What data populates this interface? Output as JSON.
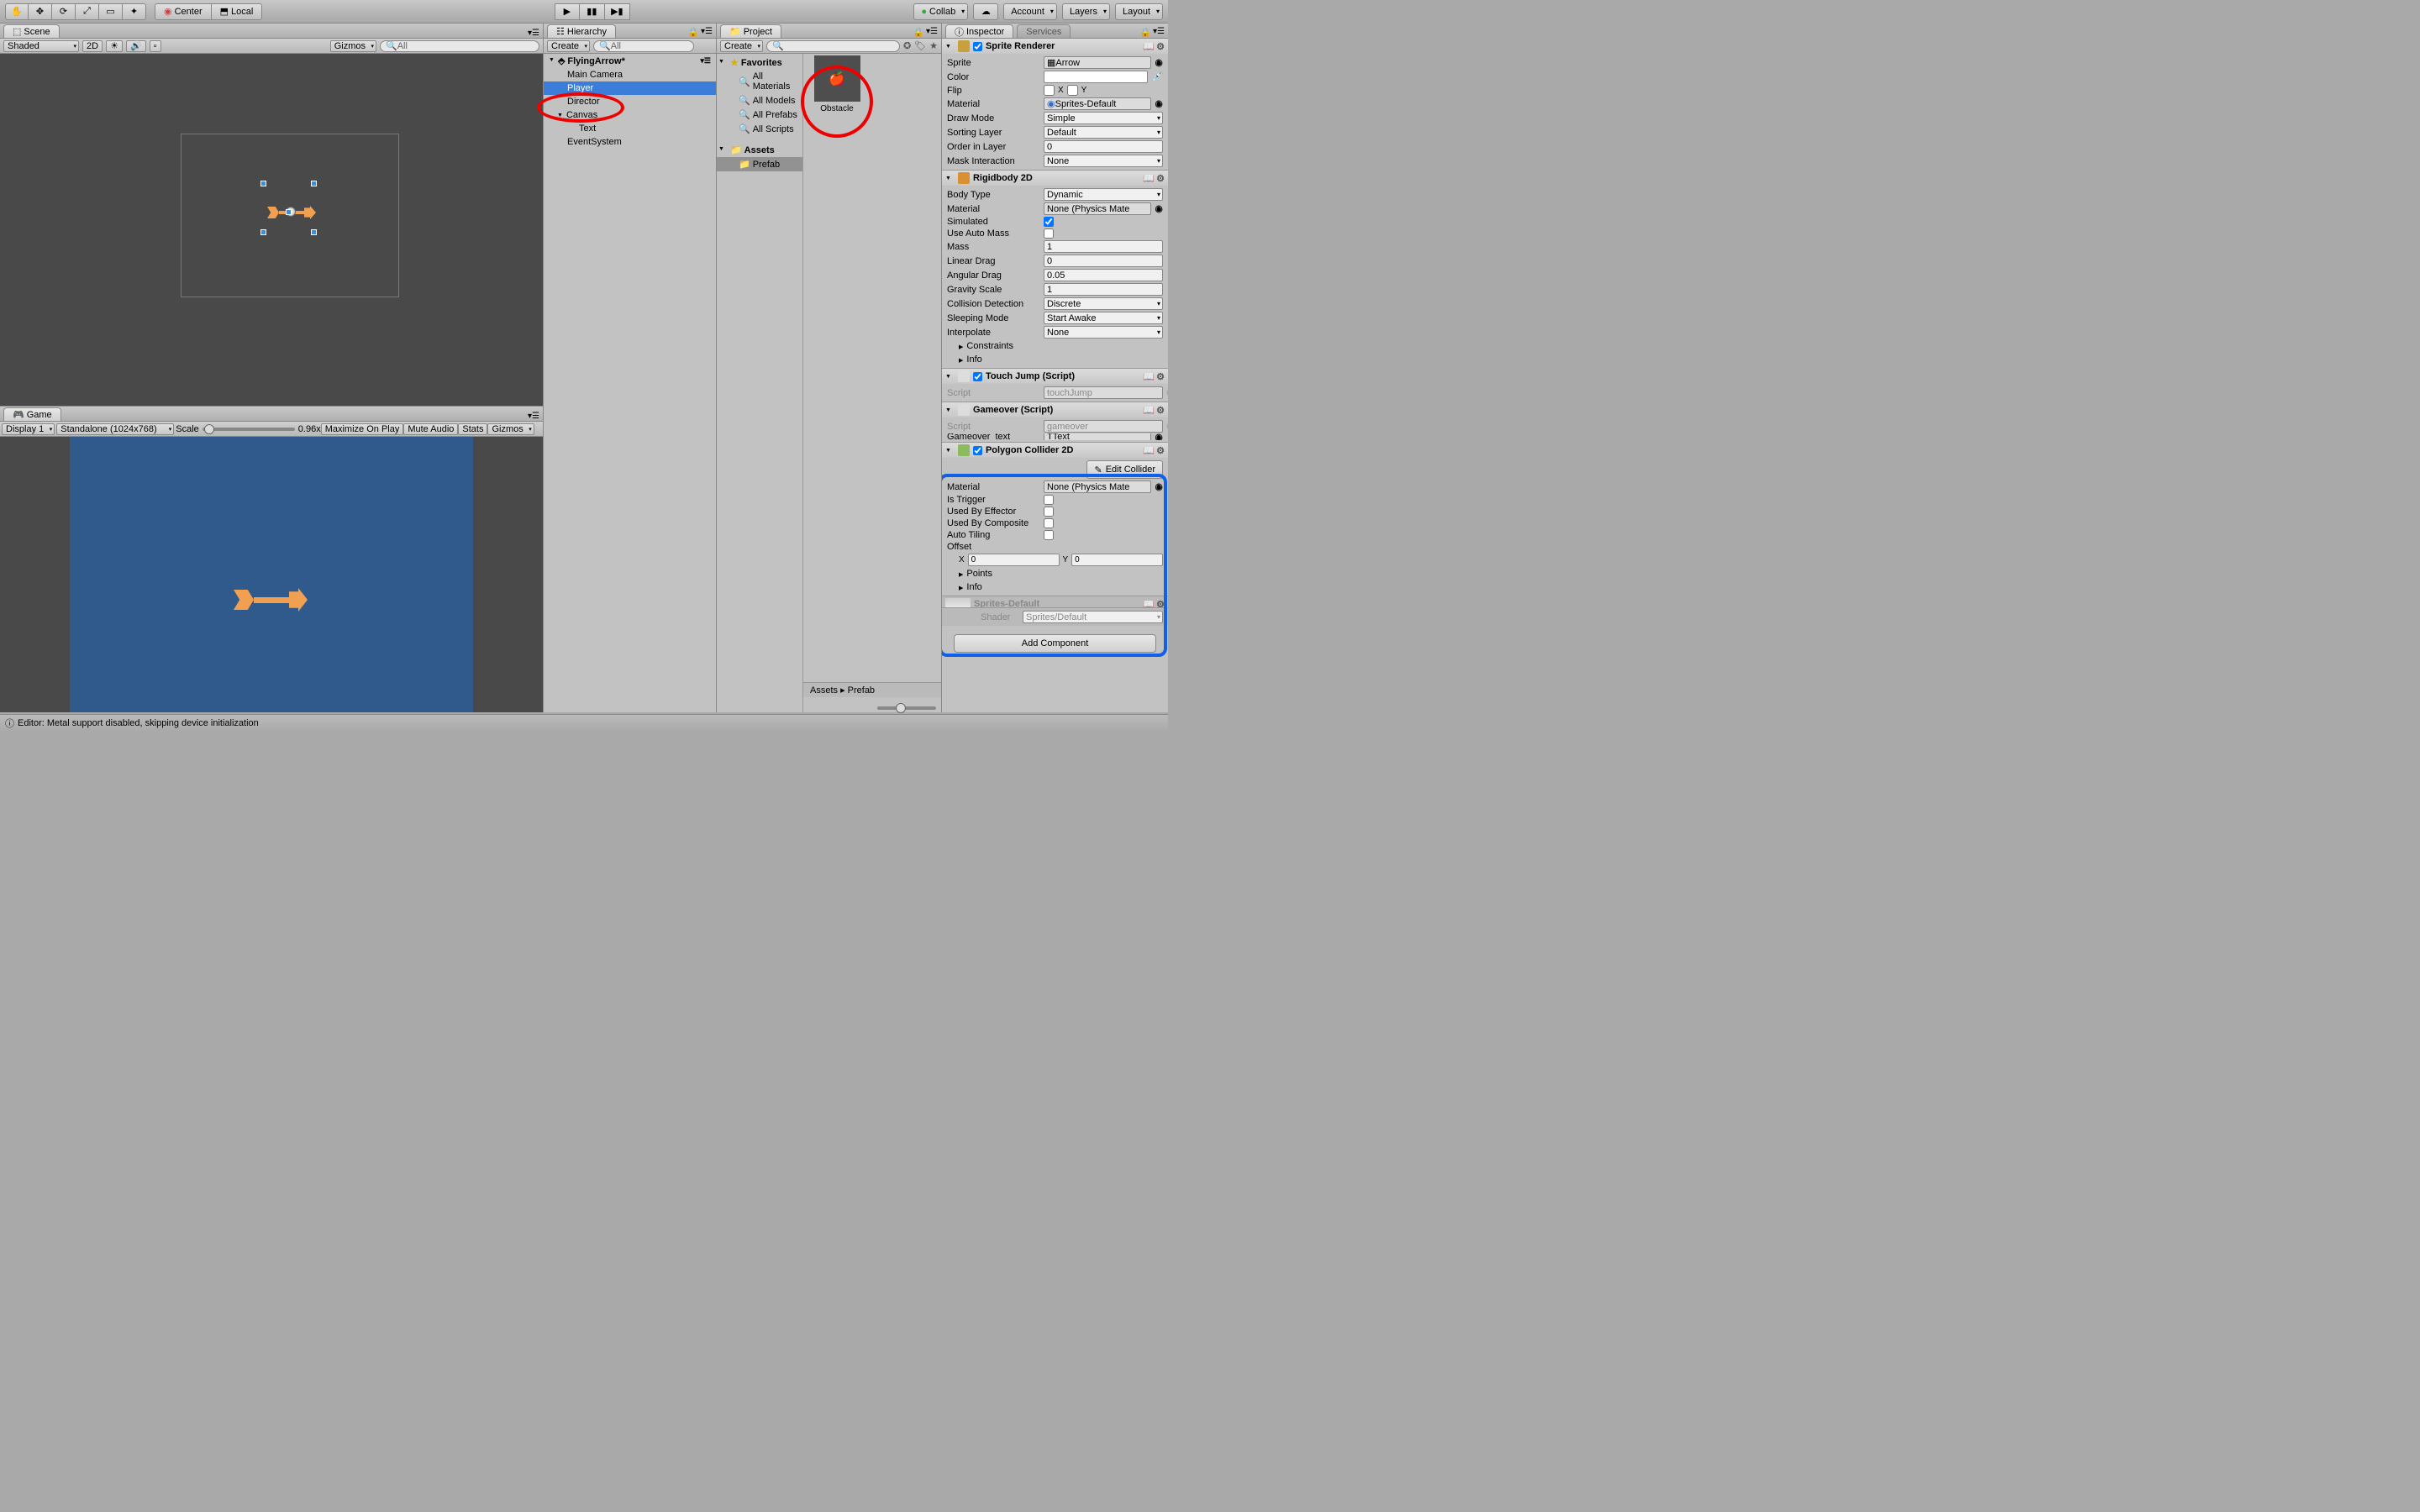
{
  "toolbar": {
    "center": "Center",
    "local": "Local",
    "collab": "Collab",
    "account": "Account",
    "layers": "Layers",
    "layout": "Layout"
  },
  "scene": {
    "tab": "Scene",
    "shading": "Shaded",
    "twod": "2D",
    "gizmos": "Gizmos",
    "search": "All"
  },
  "game": {
    "tab": "Game",
    "display": "Display 1",
    "resolution": "Standalone (1024x768)",
    "scale_label": "Scale",
    "scale_val": "0.96x",
    "maximize": "Maximize On Play",
    "mute": "Mute Audio",
    "stats": "Stats",
    "gizmos": "Gizmos"
  },
  "hierarchy": {
    "tab": "Hierarchy",
    "create": "Create",
    "scene_name": "FlyingArrow*",
    "items": [
      "Main Camera",
      "Player",
      "Director",
      "Canvas",
      "Text",
      "EventSystem"
    ]
  },
  "project": {
    "tab": "Project",
    "create": "Create",
    "favorites": "Favorites",
    "fav_items": [
      "All Materials",
      "All Models",
      "All Prefabs",
      "All Scripts"
    ],
    "assets": "Assets",
    "prefab_folder": "Prefab",
    "crumb": "Assets ▸ Prefab",
    "prefab_name": "Obstacle"
  },
  "inspector": {
    "tab_inspector": "Inspector",
    "tab_services": "Services",
    "sprite_renderer": {
      "title": "Sprite Renderer",
      "sprite_l": "Sprite",
      "sprite_v": "Arrow",
      "color_l": "Color",
      "flip_l": "Flip",
      "material_l": "Material",
      "material_v": "Sprites-Default",
      "drawmode_l": "Draw Mode",
      "drawmode_v": "Simple",
      "sortlayer_l": "Sorting Layer",
      "sortlayer_v": "Default",
      "orderlayer_l": "Order in Layer",
      "orderlayer_v": "0",
      "mask_l": "Mask Interaction",
      "mask_v": "None"
    },
    "rigidbody": {
      "title": "Rigidbody 2D",
      "bodytype_l": "Body Type",
      "bodytype_v": "Dynamic",
      "material_l": "Material",
      "material_v": "None (Physics Mate",
      "simulated_l": "Simulated",
      "automass_l": "Use Auto Mass",
      "mass_l": "Mass",
      "mass_v": "1",
      "lindrag_l": "Linear Drag",
      "lindrag_v": "0",
      "angdrag_l": "Angular Drag",
      "angdrag_v": "0.05",
      "gravity_l": "Gravity Scale",
      "gravity_v": "1",
      "collision_l": "Collision Detection",
      "collision_v": "Discrete",
      "sleep_l": "Sleeping Mode",
      "sleep_v": "Start Awake",
      "interp_l": "Interpolate",
      "interp_v": "None",
      "constraints": "Constraints",
      "info": "Info"
    },
    "touchjump": {
      "title": "Touch Jump (Script)",
      "script_l": "Script",
      "script_v": "touchJump"
    },
    "gameover": {
      "title": "Gameover (Script)",
      "script_l": "Script",
      "script_v": "gameover",
      "gotext_l": "Gameover_text",
      "gotext_v": "Text"
    },
    "polygon": {
      "title": "Polygon Collider 2D",
      "edit": "Edit Collider",
      "material_l": "Material",
      "material_v": "None (Physics Mate",
      "trigger_l": "Is Trigger",
      "effector_l": "Used By Effector",
      "composite_l": "Used By Composite",
      "autotile_l": "Auto Tiling",
      "offset_l": "Offset",
      "ox": "0",
      "oy": "0",
      "points": "Points",
      "info": "Info"
    },
    "mat_footer": {
      "name": "Sprites-Default",
      "shader_l": "Shader",
      "shader_v": "Sprites/Default"
    },
    "add_component": "Add Component"
  },
  "status": "Editor: Metal support disabled, skipping device initialization"
}
